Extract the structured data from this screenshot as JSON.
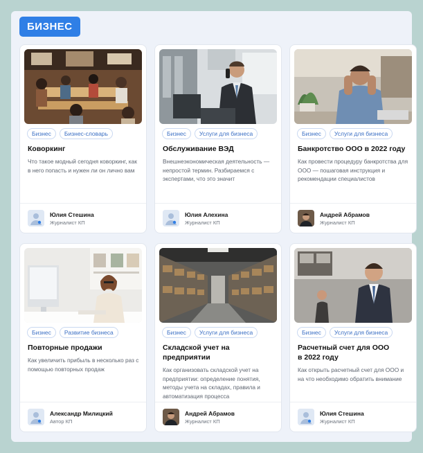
{
  "section": {
    "badge": "БИЗНЕС"
  },
  "cards": [
    {
      "image": "coworking-photo",
      "tags": [
        "Бизнес",
        "Бизнес-словарь"
      ],
      "title": "Коворкинг",
      "description": "Что такое модный сегодня коворкинг, как в него попасть и нужен ли он лично вам",
      "author": {
        "name": "Юлия Стешина",
        "role": "Журналист КП",
        "avatar": "placeholder-avatar-icon"
      }
    },
    {
      "image": "businessman-phone-photo",
      "tags": [
        "Бизнес",
        "Услуги для бизнеса"
      ],
      "title": "Обслуживание ВЭД",
      "description": "Внешнеэкономическая деятельность — непростой термин. Разбираемся с экспертами, что это значит",
      "author": {
        "name": "Юлия Алехина",
        "role": "Журналист КП",
        "avatar": "placeholder-avatar-icon"
      }
    },
    {
      "image": "stressed-man-photo",
      "tags": [
        "Бизнес",
        "Услуги для бизнеса"
      ],
      "title": "Банкротство ООО в 2022 году",
      "description": "Как провести процедуру банкротства для ООО — пошаговая инструкция и рекомендации специалистов",
      "author": {
        "name": "Андрей Абрамов",
        "role": "Журналист КП",
        "avatar": "photo-avatar"
      }
    },
    {
      "image": "woman-office-phone-photo",
      "tags": [
        "Бизнес",
        "Развитие бизнеса"
      ],
      "title": "Повторные продажи",
      "description": "Как увеличить прибыль в несколько раз с помощью повторных продаж",
      "author": {
        "name": "Александр Милицкий",
        "role": "Автор КП",
        "avatar": "placeholder-avatar-icon"
      }
    },
    {
      "image": "warehouse-photo",
      "tags": [
        "Бизнес",
        "Услуги для бизнеса"
      ],
      "title": "Складской учет на предприятии",
      "description": "Как организовать складской учет на предприятии: определение понятия, методы учета на складах, правила и автоматизация процесса",
      "author": {
        "name": "Андрей Абрамов",
        "role": "Журналист КП",
        "avatar": "photo-avatar"
      }
    },
    {
      "image": "smiling-businessman-photo",
      "tags": [
        "Бизнес",
        "Услуги для бизнеса"
      ],
      "title": "Расчетный счет для ООО в 2022 году",
      "description": "Как открыть расчетный счет для ООО и на что необходимо обратить внимание",
      "author": {
        "name": "Юлия Стешина",
        "role": "Журналист КП",
        "avatar": "placeholder-avatar-icon"
      }
    }
  ],
  "colors": {
    "accent": "#2f7fe6",
    "background": "#eef2f9",
    "frame": "#b9d3d0"
  }
}
